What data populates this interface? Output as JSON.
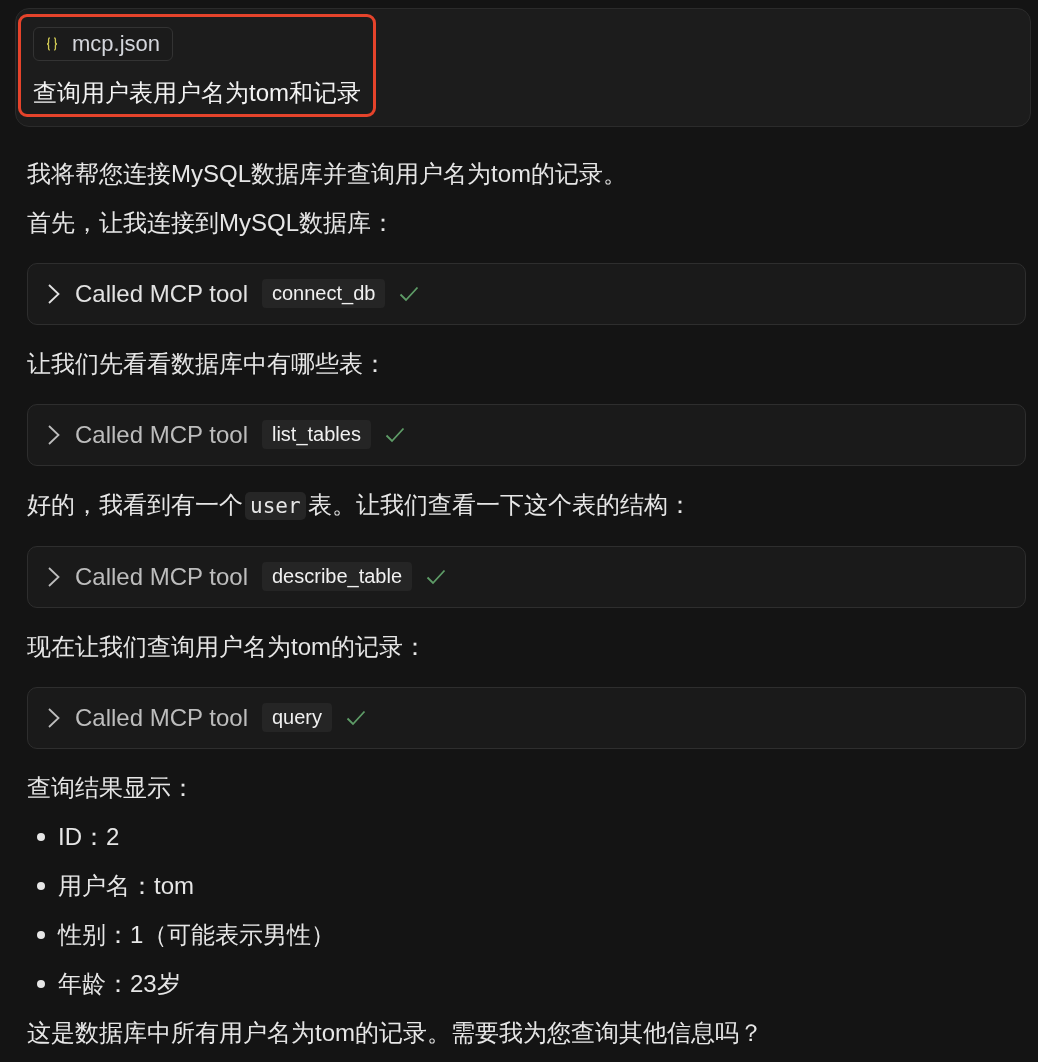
{
  "user_message": {
    "highlighted": true,
    "attachment": {
      "label": "mcp.json"
    },
    "text": "查询用户表用户名为tom和记录"
  },
  "response": [
    {
      "kind": "paragraph",
      "segments": [
        {
          "kind": "text",
          "text": "我将帮您连接MySQL数据库并查询用户名为tom的记录。"
        }
      ]
    },
    {
      "kind": "paragraph",
      "segments": [
        {
          "kind": "text",
          "text": "首先，让我连接到MySQL数据库："
        }
      ]
    },
    {
      "kind": "tool_call",
      "label": "Called MCP tool",
      "tool": "connect_db",
      "expanded": false,
      "hovered": true,
      "succeeded": true
    },
    {
      "kind": "paragraph",
      "segments": [
        {
          "kind": "text",
          "text": "让我们先看看数据库中有哪些表："
        }
      ]
    },
    {
      "kind": "tool_call",
      "label": "Called MCP tool",
      "tool": "list_tables",
      "expanded": false,
      "hovered": false,
      "succeeded": true
    },
    {
      "kind": "paragraph",
      "segments": [
        {
          "kind": "text",
          "text": "好的，我看到有一个"
        },
        {
          "kind": "code",
          "text": "user"
        },
        {
          "kind": "text",
          "text": "表。让我们查看一下这个表的结构："
        }
      ]
    },
    {
      "kind": "tool_call",
      "label": "Called MCP tool",
      "tool": "describe_table",
      "expanded": false,
      "hovered": false,
      "succeeded": true
    },
    {
      "kind": "paragraph",
      "segments": [
        {
          "kind": "text",
          "text": "现在让我们查询用户名为tom的记录："
        }
      ]
    },
    {
      "kind": "tool_call",
      "label": "Called MCP tool",
      "tool": "query",
      "expanded": false,
      "hovered": false,
      "succeeded": true
    },
    {
      "kind": "paragraph",
      "segments": [
        {
          "kind": "text",
          "text": "查询结果显示："
        }
      ]
    },
    {
      "kind": "list",
      "items": [
        "ID：2",
        "用户名：tom",
        "性别：1（可能表示男性）",
        "年龄：23岁"
      ]
    },
    {
      "kind": "paragraph",
      "segments": [
        {
          "kind": "text",
          "text": "这是数据库中所有用户名为tom的记录。需要我为您查询其他信息吗？"
        }
      ]
    }
  ]
}
